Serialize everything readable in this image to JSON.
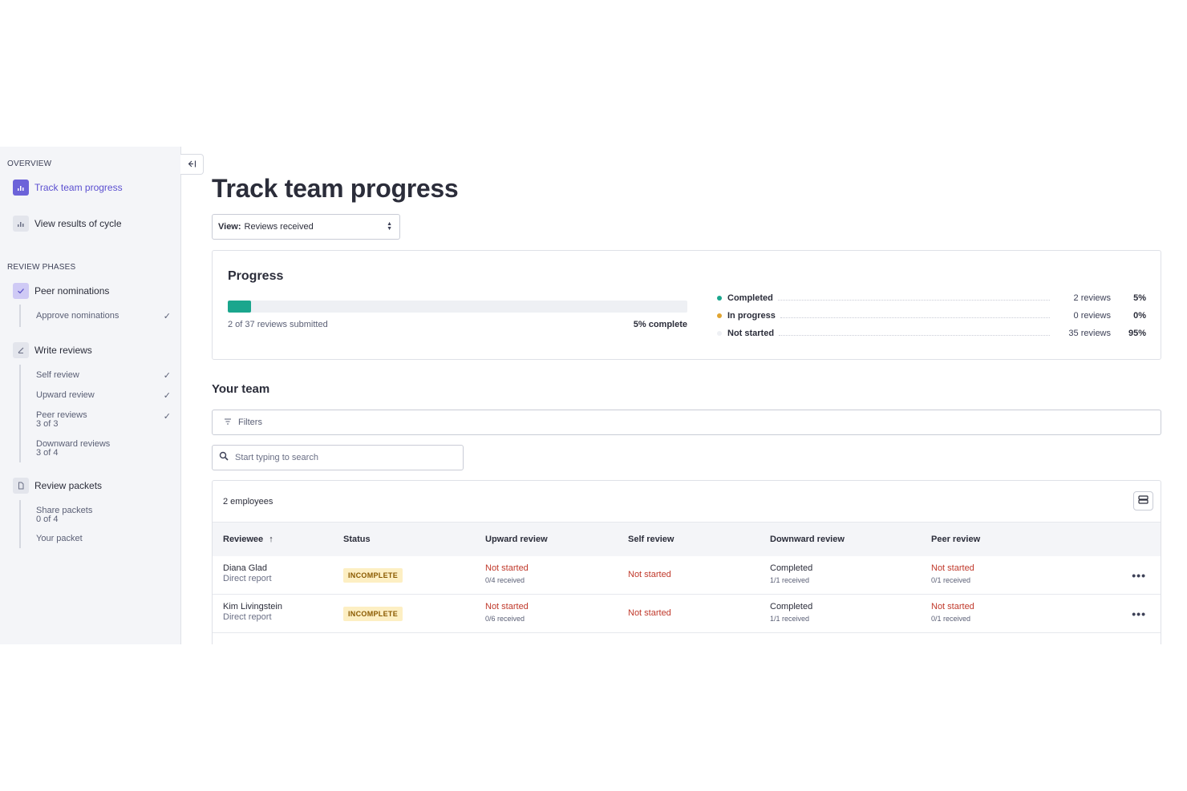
{
  "sidebar": {
    "overview_title": "OVERVIEW",
    "overview_items": [
      {
        "label": "Track team progress",
        "icon": "bar-chart-icon",
        "active": true
      },
      {
        "label": "View results of cycle",
        "icon": "bar-chart-icon",
        "active": false
      }
    ],
    "phases_title": "REVIEW PHASES",
    "phases": [
      {
        "label": "Peer nominations",
        "icon": "check-icon",
        "subitems": [
          {
            "label": "Approve nominations",
            "detail": "",
            "done": true
          }
        ]
      },
      {
        "label": "Write reviews",
        "icon": "pencil-icon",
        "subitems": [
          {
            "label": "Self review",
            "detail": "",
            "done": true
          },
          {
            "label": "Upward review",
            "detail": "",
            "done": true
          },
          {
            "label": "Peer reviews",
            "detail": "3 of 3",
            "done": true
          },
          {
            "label": "Downward reviews",
            "detail": "3 of 4",
            "done": false
          }
        ]
      },
      {
        "label": "Review packets",
        "icon": "document-icon",
        "subitems": [
          {
            "label": "Share packets",
            "detail": "0 of 4",
            "done": false
          },
          {
            "label": "Your packet",
            "detail": "",
            "done": false
          }
        ]
      }
    ]
  },
  "page": {
    "title": "Track team progress",
    "view_label": "View:",
    "view_value": "Reviews received"
  },
  "progress": {
    "title": "Progress",
    "fraction_complete": 0.05,
    "submitted_text": "2 of 37 reviews submitted",
    "percent_text": "5% complete",
    "legend": [
      {
        "label": "Completed",
        "count": "2 reviews",
        "pct": "5%",
        "color": "#1aa68d"
      },
      {
        "label": "In progress",
        "count": "0 reviews",
        "pct": "0%",
        "color": "#e0a532"
      },
      {
        "label": "Not started",
        "count": "35 reviews",
        "pct": "95%",
        "color": "#eef0f4"
      }
    ]
  },
  "team": {
    "title": "Your team",
    "filters_label": "Filters",
    "search_placeholder": "Start typing to search",
    "employee_count": "2 employees",
    "columns": [
      "Reviewee",
      "Status",
      "Upward review",
      "Self review",
      "Downward review",
      "Peer review"
    ],
    "sort_indicator": "↑",
    "rows": [
      {
        "name": "Diana Glad",
        "relation": "Direct report",
        "status": "INCOMPLETE",
        "upward": {
          "status": "Not started",
          "detail": "0/4 received"
        },
        "self": {
          "status": "Not started"
        },
        "downward": {
          "status": "Completed",
          "detail": "1/1 received"
        },
        "peer": {
          "status": "Not started",
          "detail": "0/1 received"
        }
      },
      {
        "name": "Kim Livingstein",
        "relation": "Direct report",
        "status": "INCOMPLETE",
        "upward": {
          "status": "Not started",
          "detail": "0/6 received"
        },
        "self": {
          "status": "Not started"
        },
        "downward": {
          "status": "Completed",
          "detail": "1/1 received"
        },
        "peer": {
          "status": "Not started",
          "detail": "0/1 received"
        }
      }
    ]
  },
  "colors": {
    "accent": "#6c63d9",
    "progress_fill": "#1aa68d",
    "badge_bg": "#fdefc3",
    "not_started": "#c0392b"
  }
}
